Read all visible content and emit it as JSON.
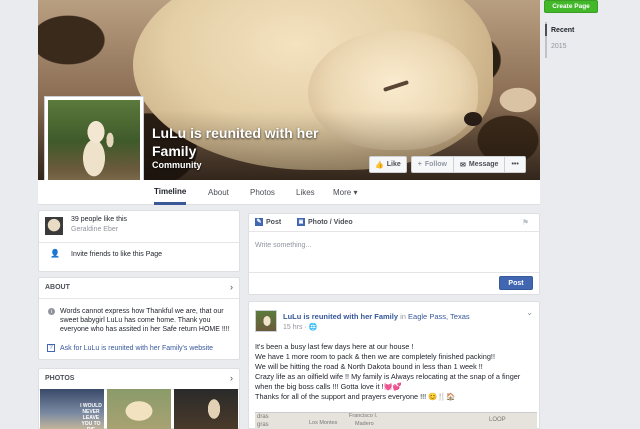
{
  "cover": {
    "page_title": "LuLu is reunited with her Family",
    "category": "Community",
    "like_label": "Like",
    "follow_label": "Follow",
    "message_label": "Message",
    "more_label": "•••"
  },
  "nav": {
    "tabs": [
      "Timeline",
      "About",
      "Photos",
      "Likes",
      "More ▾"
    ]
  },
  "right_sidebar": {
    "create_page_label": "Create Page",
    "years": [
      "Recent",
      "2015"
    ]
  },
  "left": {
    "likes_text": "39 people like this",
    "liker_name": "Geraldine Eber",
    "invite_text": "Invite friends to like this Page",
    "about_header": "ABOUT",
    "about_text": "Words cannot express how Thankful we are, that our sweet babygirl LuLu has come home. Thank you everyone who has assited in her Safe return HOME !!!!",
    "ask_text": "Ask for LuLu is reunited with her Family's website",
    "photos_header": "PHOTOS",
    "photo_caption": "I WOULD NEVER LEAVE YOU TO DIE"
  },
  "composer": {
    "post_tab": "Post",
    "photo_tab": "Photo / Video",
    "placeholder": "Write something...",
    "post_button": "Post"
  },
  "feed_post": {
    "author": "LuLu is reunited with her Family",
    "location_prefix": "in",
    "location": "Eagle Pass, Texas",
    "time": "15 hrs",
    "lines": [
      "It's been a busy last few days here at our house !",
      "We have 1 more room to pack & then we are completely finished packing!!",
      "We will be hitting the road & North Dakota bound in less than 1 week !!",
      "Crazy life as an oilfield wife !! My family is Always relocating at the snap of a finger when the big boss calls !!! Gotta love it !💓💕",
      "Thanks for all of the support and prayers everyone !!! 😊🍴🏠"
    ],
    "map_labels": [
      "dras",
      "gras",
      "Francisco I.",
      "Madero",
      "Los Montes",
      "LOOP"
    ]
  },
  "colors": {
    "brand": "#3b5998",
    "button": "#4267b2",
    "create_green": "#42b72a",
    "background": "#e9ebee"
  }
}
